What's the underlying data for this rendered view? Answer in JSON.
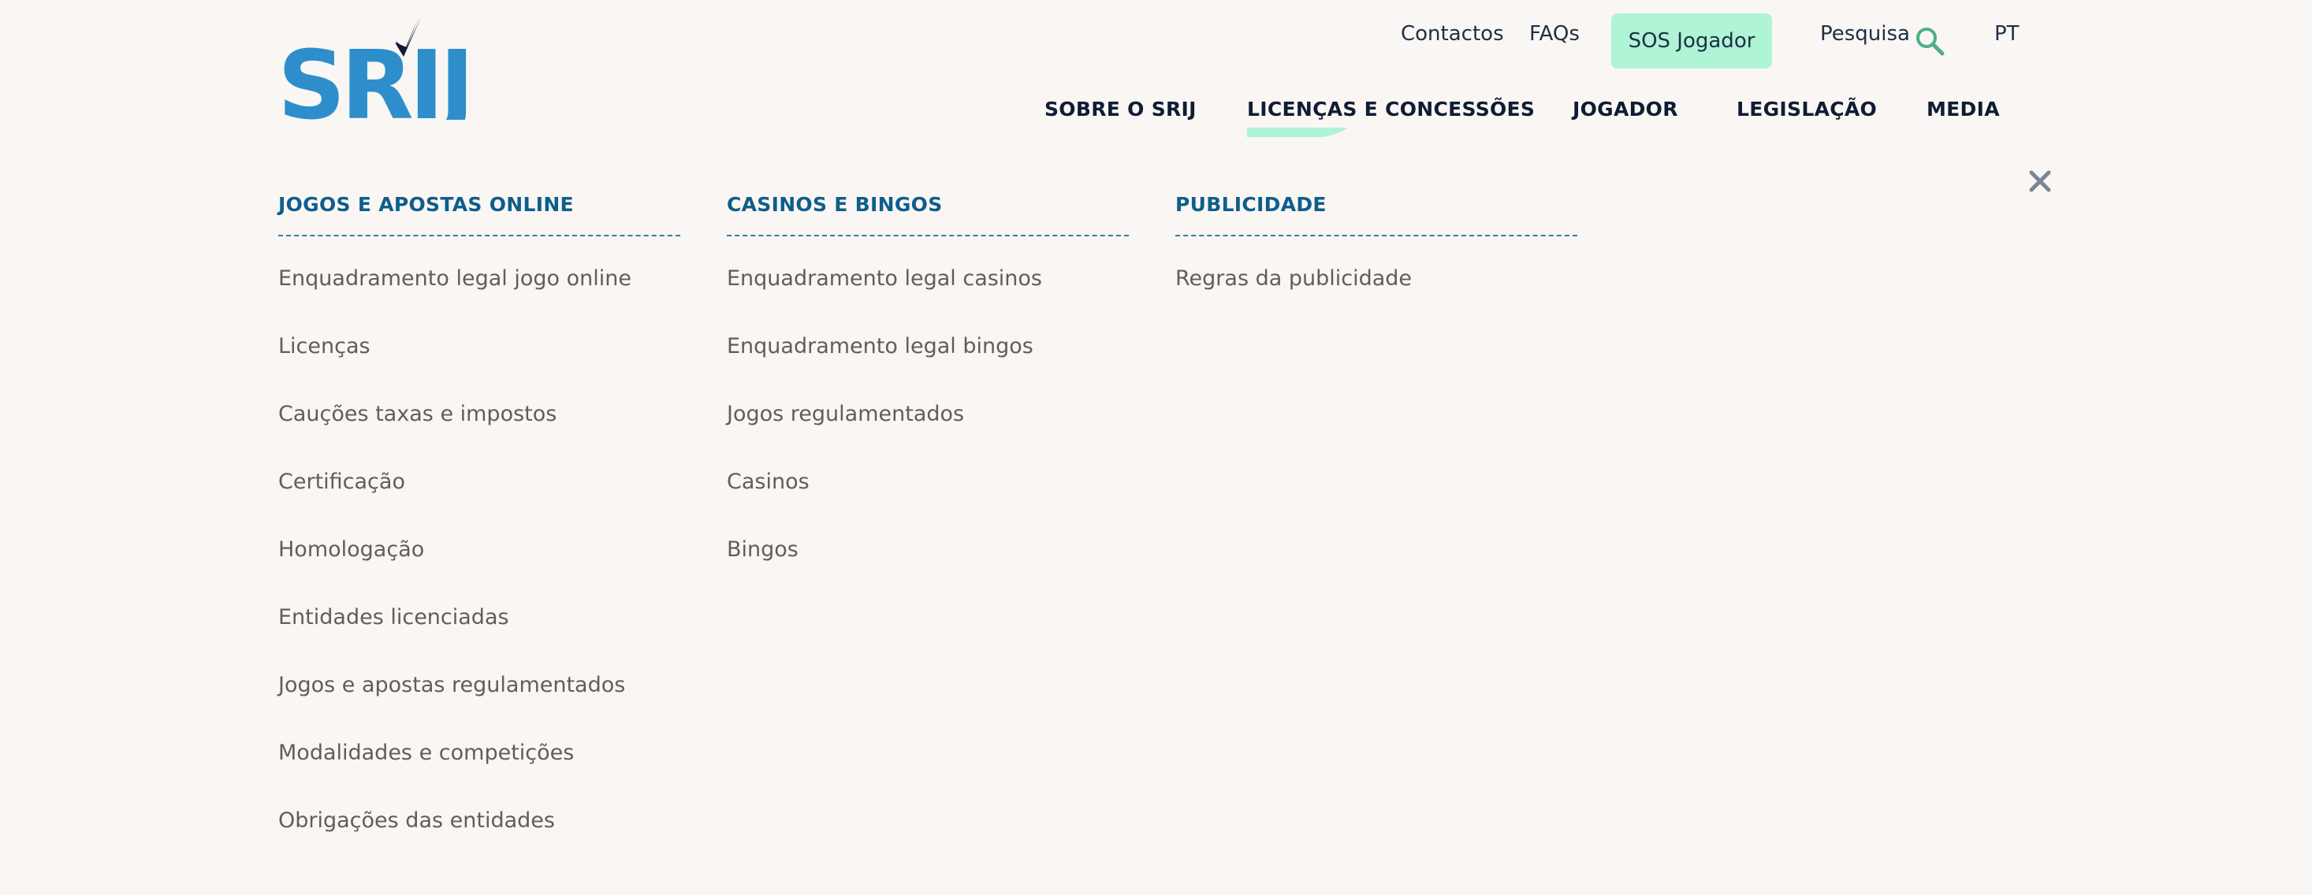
{
  "logo": {
    "text": "SRIJ",
    "colors": {
      "blue": "#2d8ecb",
      "check": "#0f1c33"
    }
  },
  "top_links": {
    "contacts": "Contactos",
    "faqs": "FAQs",
    "sos": "SOS Jogador",
    "search": "Pesquisa",
    "language": "PT"
  },
  "nav": {
    "items": [
      "SOBRE O SRIJ",
      "LICENÇAS E CONCESSÕES",
      "JOGADOR",
      "LEGISLAÇÃO",
      "MEDIA"
    ],
    "active_index": 1
  },
  "mega_menu": {
    "columns": [
      {
        "title": "JOGOS E APOSTAS ONLINE",
        "items": [
          "Enquadramento legal jogo online",
          "Licenças",
          "Cauções taxas e impostos",
          "Certificação",
          "Homologação",
          "Entidades licenciadas",
          "Jogos e apostas regulamentados",
          "Modalidades e competições",
          "Obrigações das entidades"
        ]
      },
      {
        "title": "CASINOS E BINGOS",
        "items": [
          "Enquadramento legal casinos",
          "Enquadramento legal bingos",
          "Jogos regulamentados",
          "Casinos",
          "Bingos"
        ]
      },
      {
        "title": "PUBLICIDADE",
        "items": [
          "Regras da publicidade"
        ]
      }
    ]
  },
  "icons": {
    "search": "search-icon",
    "close": "close-icon",
    "accent": "#aef4d5",
    "search_color": "#4caf8a"
  }
}
